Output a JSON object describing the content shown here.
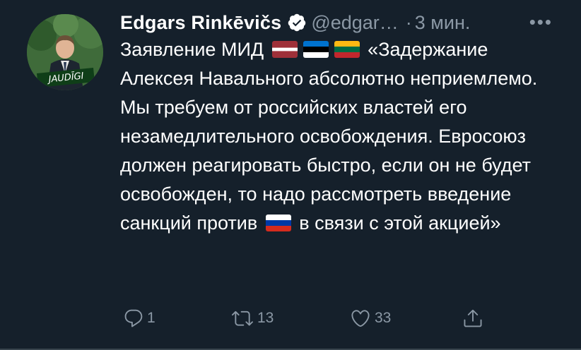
{
  "tweet": {
    "author_name": "Edgars Rinkēvičs",
    "handle": "@edgar…",
    "separator": "·",
    "time": "3 мин.",
    "more_label": "•••",
    "avatar_badge_text": "JAUDĪGI",
    "text_part1": "Заявление МИД",
    "flags_line1": [
      "latvia-flag",
      "estonia-flag",
      "lithuania-flag"
    ],
    "text_part2": "«Задержание Алексея Навального абсолютно неприемлемо. Мы требуем от российских властей его незамедлительного освобождения. Евросоюз должен реагировать быстро, если он не будет освобожден, то надо рассмотреть введение санкций против",
    "flag_inline": "russia-flag",
    "text_part3": "в связи с этой акцией»"
  },
  "actions": {
    "reply_count": "1",
    "retweet_count": "13",
    "like_count": "33"
  },
  "colors": {
    "background": "#15202b",
    "secondary_text": "#8b98a5",
    "divider": "#38444d",
    "verified_badge": "#ffffff"
  }
}
